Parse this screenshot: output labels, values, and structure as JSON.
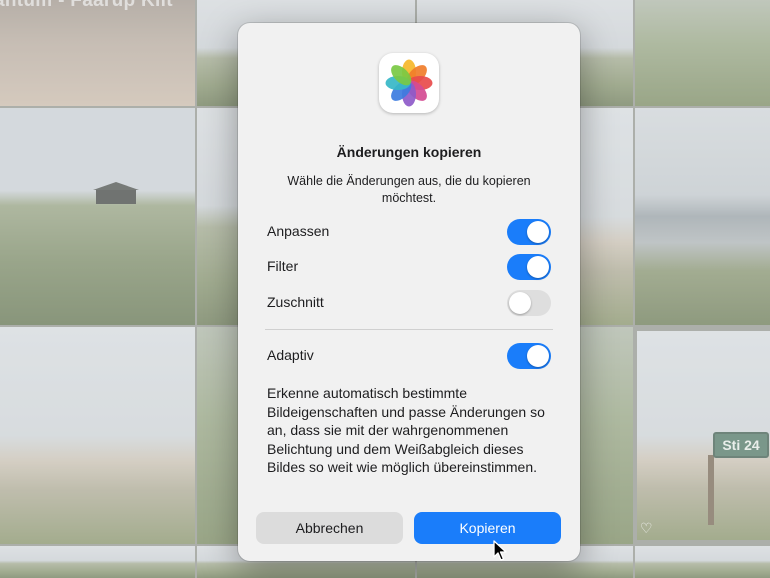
{
  "background": {
    "album_title": "antum - Faarup Klit",
    "sign_text": "Sti 24"
  },
  "dialog": {
    "title": "Änderungen kopieren",
    "subtitle": "Wähle die Änderungen aus, die du kopieren möchtest.",
    "options": [
      {
        "label": "Anpassen",
        "enabled": true
      },
      {
        "label": "Filter",
        "enabled": true
      },
      {
        "label": "Zuschnitt",
        "enabled": false
      }
    ],
    "adaptive": {
      "label": "Adaptiv",
      "enabled": true
    },
    "description": "Erkenne automatisch bestimmte Bildeigenschaften und passe Änderungen so an, dass sie mit der wahrgenommenen Belichtung und dem Weißabgleich dieses Bildes so weit wie möglich übereinstimmen.",
    "cancel_label": "Abbrechen",
    "confirm_label": "Kopieren"
  },
  "colors": {
    "accent": "#1a7dfa",
    "toggle_off": "#dedede"
  },
  "icons": {
    "app_icon": "photos-app-icon",
    "cursor": "mouse-pointer-icon",
    "favorite": "heart-icon"
  }
}
